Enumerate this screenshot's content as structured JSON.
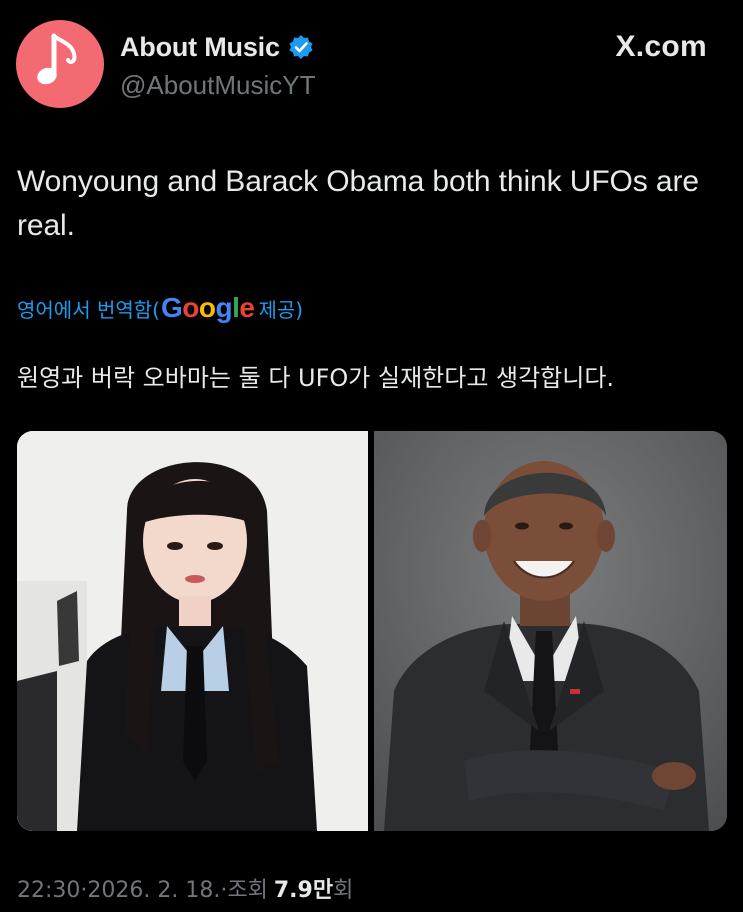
{
  "post": {
    "author": {
      "display_name": "About Music",
      "handle": "@AboutMusicYT",
      "verified": true,
      "avatar_icon": "music-note-icon",
      "avatar_color": "#f46a73"
    },
    "site_label": "X.com",
    "text": "Wonyoung and Barack Obama both think UFOs are real.",
    "translation": {
      "prefix": "영어에서 번역함(",
      "provider": "Google",
      "suffix": " 제공)",
      "text": "원영과 버락 오바마는 둘 다 UFO가 실재한다고 생각합니다."
    },
    "media": [
      {
        "icon": "person-photo-icon"
      },
      {
        "icon": "person-photo-icon"
      }
    ],
    "meta": {
      "time": "22:30",
      "date": "2026. 2. 18.",
      "views_label": "조회",
      "views_count": "7.9만",
      "views_suffix": "회",
      "separator": " · "
    }
  },
  "colors": {
    "background": "#000000",
    "text": "#e7e9ea",
    "muted": "#71767b",
    "link": "#1d9bf0",
    "verified": "#1d9bf0"
  }
}
